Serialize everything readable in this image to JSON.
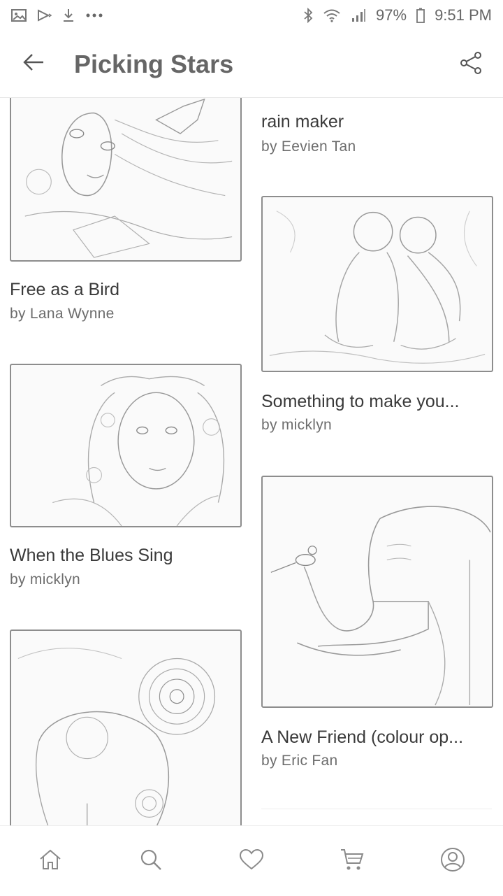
{
  "status_bar": {
    "left_icons": [
      "image-icon",
      "play-icon",
      "download-icon",
      "more-dots-icon"
    ],
    "right_icons": [
      "bluetooth-icon",
      "wifi-icon",
      "signal-icon"
    ],
    "battery": "97%",
    "time": "9:51 PM"
  },
  "appbar": {
    "title": "Picking Stars",
    "back_icon": "arrow-left-icon",
    "share_icon": "share-icon"
  },
  "items": [
    {
      "title": "rain maker",
      "author": "by Eevien Tan"
    },
    {
      "title": "Free as a Bird",
      "author": "by Lana Wynne"
    },
    {
      "title": "Something to make you...",
      "author": "by micklyn"
    },
    {
      "title": "When the Blues Sing",
      "author": "by micklyn"
    },
    {
      "title": "A New Friend (colour op...",
      "author": "by Eric Fan"
    }
  ],
  "bottom_nav": [
    "home-icon",
    "search-icon",
    "heart-icon",
    "cart-icon",
    "account-icon"
  ],
  "colors": {
    "icon": "#777777",
    "border": "#8d8d8d",
    "text": "#3a3a3a"
  }
}
